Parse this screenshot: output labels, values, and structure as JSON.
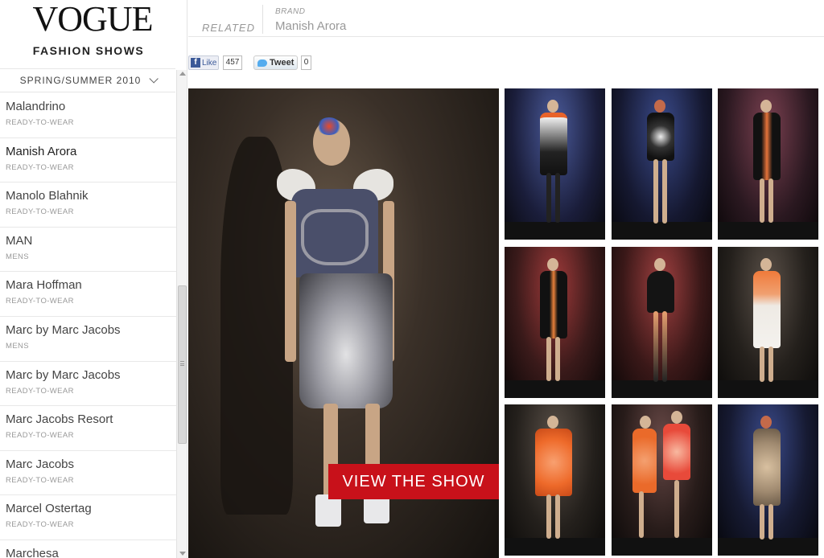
{
  "brand_logo": "VOGUE",
  "subtitle": "FASHION SHOWS",
  "season": {
    "label": "SPRING/SUMMER 2010",
    "chevron_icon": "chevron-down-icon"
  },
  "designers": [
    {
      "name": "Malandrino",
      "category": "READY-TO-WEAR"
    },
    {
      "name": "Manish Arora",
      "category": "READY-TO-WEAR"
    },
    {
      "name": "Manolo Blahnik",
      "category": "READY-TO-WEAR"
    },
    {
      "name": "MAN",
      "category": "MENS"
    },
    {
      "name": "Mara Hoffman",
      "category": "READY-TO-WEAR"
    },
    {
      "name": "Marc by Marc Jacobs",
      "category": "MENS"
    },
    {
      "name": "Marc by Marc Jacobs",
      "category": "READY-TO-WEAR"
    },
    {
      "name": "Marc Jacobs Resort",
      "category": "READY-TO-WEAR"
    },
    {
      "name": "Marc Jacobs",
      "category": "READY-TO-WEAR"
    },
    {
      "name": "Marcel Ostertag",
      "category": "READY-TO-WEAR"
    },
    {
      "name": "Marchesa",
      "category": ""
    }
  ],
  "active_designer_index": 1,
  "header": {
    "related_label": "RELATED",
    "brand_label": "BRAND",
    "brand_value": "Manish Arora"
  },
  "social": {
    "like_label": "Like",
    "like_count": "457",
    "tweet_label": "Tweet",
    "tweet_count": "0"
  },
  "view_show_label": "VIEW THE SHOW",
  "colors": {
    "accent_red": "#c8111a",
    "fb_blue": "#3b5998",
    "twitter_blue": "#55acee"
  }
}
